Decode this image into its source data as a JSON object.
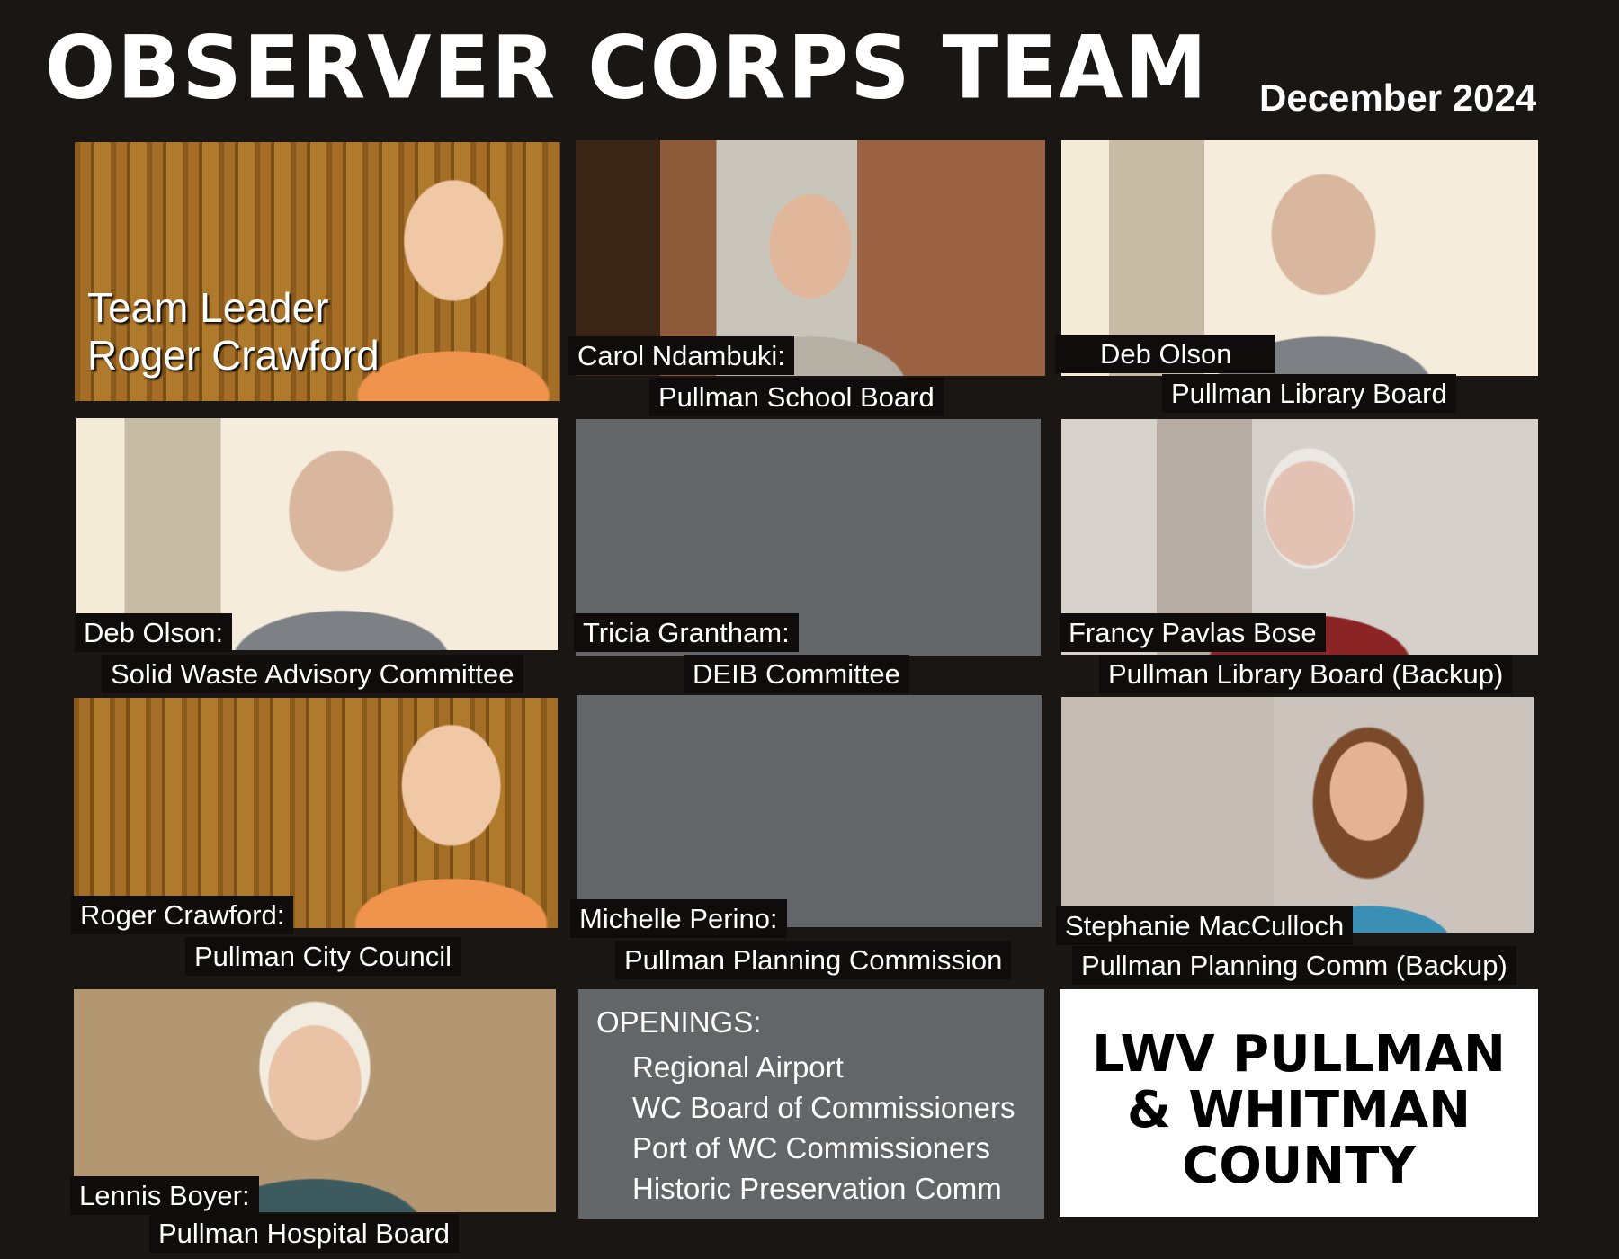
{
  "header": {
    "title": "OBSERVER CORPS TEAM",
    "date": "December 2024"
  },
  "leader": {
    "line1": "Team Leader",
    "line2": "Roger Crawford"
  },
  "members": [
    {
      "name": "Carol Ndambuki:",
      "role": "Pullman School Board"
    },
    {
      "name": "Deb Olson",
      "role": "Pullman Library Board"
    },
    {
      "name": "Deb Olson:",
      "role": "Solid Waste Advisory Committee"
    },
    {
      "name": "Tricia Grantham:",
      "role": "DEIB Committee"
    },
    {
      "name": "Francy Pavlas Bose",
      "role": "Pullman Library Board (Backup)"
    },
    {
      "name": "Roger Crawford:",
      "role": "Pullman City Council"
    },
    {
      "name": "Michelle Perino:",
      "role": "Pullman Planning Commission"
    },
    {
      "name": "Stephanie MacCulloch",
      "role": "Pullman Planning Comm (Backup)"
    },
    {
      "name": "Lennis Boyer:",
      "role": "Pullman Hospital Board"
    }
  ],
  "openings": {
    "heading": "OPENINGS:",
    "items": [
      "Regional Airport",
      "WC Board of Commissioners",
      "Port of WC Commissioners",
      "Historic Preservation Comm"
    ]
  },
  "logo": {
    "line1": "LWV PULLMAN",
    "line2": "& WHITMAN",
    "line3": "COUNTY"
  }
}
